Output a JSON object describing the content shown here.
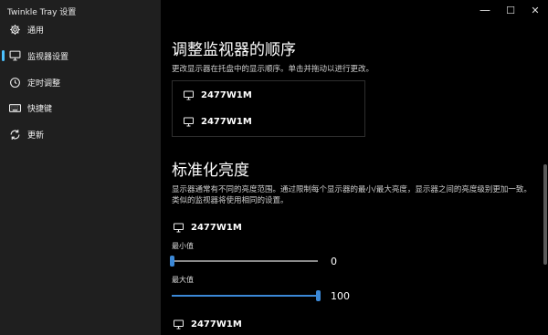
{
  "app": {
    "title": "Twinkle Tray 设置"
  },
  "sidebar": {
    "items": [
      {
        "label": "通用",
        "icon": "gear-icon"
      },
      {
        "label": "监视器设置",
        "icon": "monitor-icon"
      },
      {
        "label": "定时调整",
        "icon": "clock-icon"
      },
      {
        "label": "快捷键",
        "icon": "keyboard-icon"
      },
      {
        "label": "更新",
        "icon": "refresh-icon"
      }
    ],
    "active_index": 1
  },
  "window_controls": {
    "minimize": "—",
    "maximize": "☐",
    "close": "✕"
  },
  "reorder": {
    "title": "调整监视器的顺序",
    "description": "更改显示器在托盘中的显示顺序。单击并拖动以进行更改。",
    "monitors": [
      "2477W1M",
      "2477W1M"
    ]
  },
  "normalize": {
    "title": "标准化亮度",
    "description": "显示器通常有不同的亮度范围。通过限制每个显示器的最小/最大亮度，显示器之间的亮度级别更加一致。类似的监视器将使用相同的设置。",
    "monitors": [
      {
        "name": "2477W1M",
        "min_label": "最小值",
        "min_value": 0,
        "max_label": "最大值",
        "max_value": 100
      },
      {
        "name": "2477W1M"
      }
    ]
  },
  "colors": {
    "accent": "#3b88d6",
    "sidebar_bg": "#1f1f1f",
    "main_bg": "#000000"
  }
}
